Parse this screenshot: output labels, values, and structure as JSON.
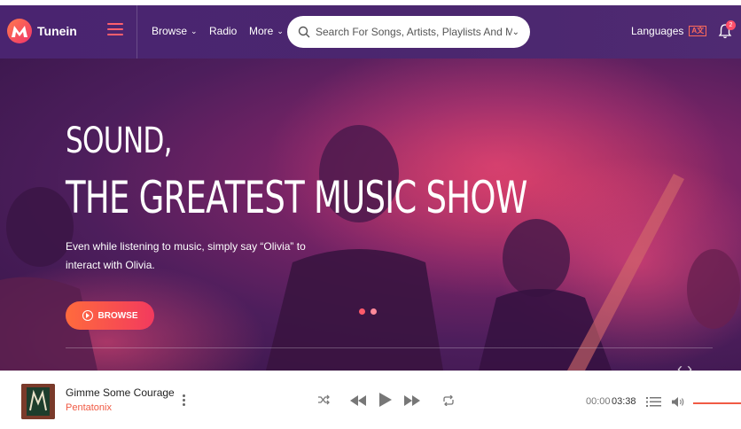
{
  "navbar": {
    "brand": "Tunein",
    "links": {
      "browse": "Browse",
      "radio": "Radio",
      "more": "More"
    },
    "search": {
      "placeholder": "Search For Songs, Artists, Playlists And More.."
    },
    "languages": "Languages",
    "notification_count": "2"
  },
  "hero": {
    "title_line1": "SOUND,",
    "title_line2": "THE GREATEST MUSIC SHOW",
    "description": "Even while listening to music, simply say “Olivia” to interact with Olivia.",
    "browse_button": "BROWSE"
  },
  "player": {
    "track_title": "Gimme Some Courage",
    "artist": "Pentatonix",
    "current_time": "00:00",
    "total_time": "03:38"
  },
  "colors": {
    "accent": "#f05a44",
    "navbar": "#4a2470",
    "button_gradient_start": "#ff6a3d",
    "button_gradient_end": "#f23a5e"
  },
  "icons": [
    "menu-icon",
    "chevron-down-icon",
    "search-icon",
    "bell-icon",
    "play-circle-icon",
    "more-vertical-icon",
    "shuffle-icon",
    "rewind-icon",
    "play-icon",
    "fast-forward-icon",
    "repeat-icon",
    "queue-list-icon",
    "volume-icon"
  ]
}
